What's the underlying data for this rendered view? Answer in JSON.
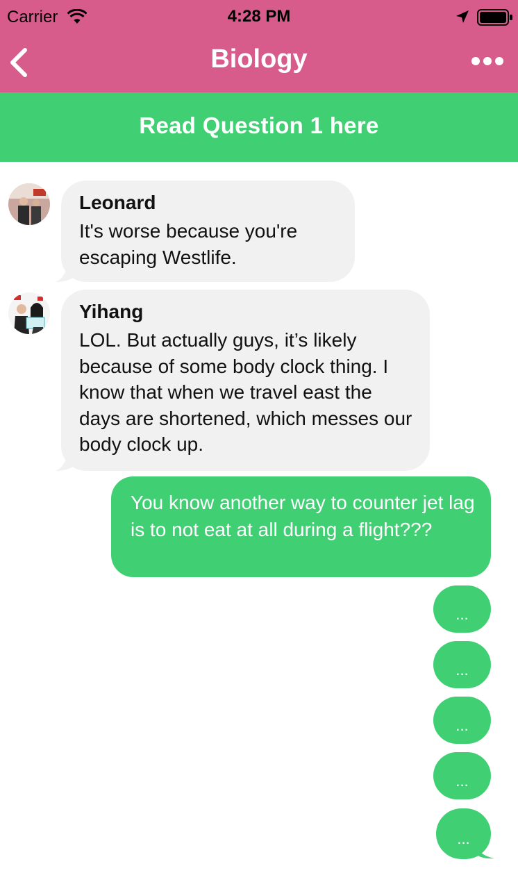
{
  "status_bar": {
    "carrier": "Carrier",
    "time": "4:28 PM"
  },
  "nav": {
    "title": "Biology"
  },
  "banner": {
    "text": "Read Question 1 here"
  },
  "colors": {
    "header_pink": "#D75C8B",
    "accent_green": "#41CF74",
    "incoming_bubble": "#F1F1F1"
  },
  "icons": {
    "back": "chevron-left-icon",
    "more": "more-dots-icon",
    "wifi": "wifi-icon",
    "location": "location-arrow-icon",
    "battery": "battery-icon"
  },
  "messages": [
    {
      "sender": "Leonard",
      "text": "It's worse because you're escaping Westlife."
    },
    {
      "sender": "Yihang",
      "text": "LOL. But actually guys, it’s likely because of some body clock thing. I know that when we travel east the days are shortened, which messes our body clock up."
    },
    {
      "sender": "",
      "text": "You know another way to counter jet lag is to not eat at all during a flight???"
    }
  ],
  "typing_indicators": [
    "...",
    "...",
    "...",
    "...",
    "..."
  ]
}
